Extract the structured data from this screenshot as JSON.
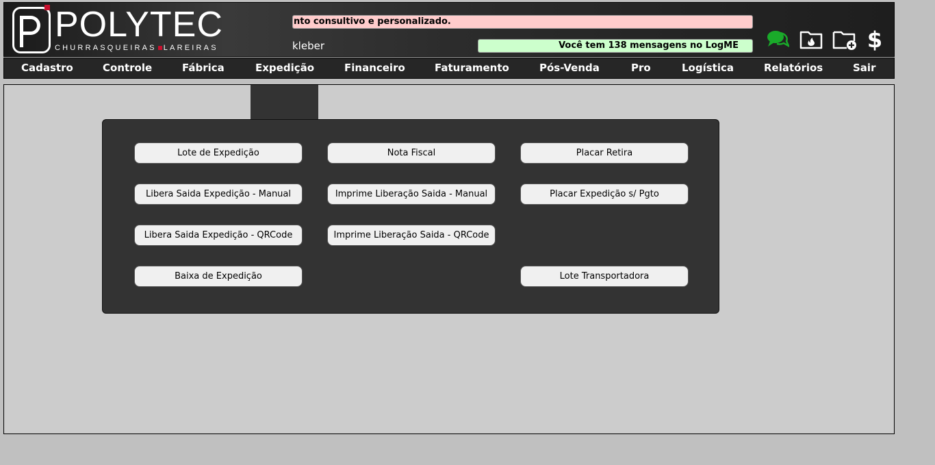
{
  "brand": {
    "name": "POLYTEC",
    "sub_left": "CHURRASQUEIRAS",
    "sub_right": "LAREIRAS",
    "accent": "#c8102e"
  },
  "ticker": {
    "text": "nto consultivo e personalizado.",
    "bg": "#ffcccc"
  },
  "user": {
    "name": "kleber"
  },
  "messages": {
    "text": "Você tem 138 mensagens no LogME",
    "bg": "#ccffcc"
  },
  "header_icons": [
    "chat-bubbles-icon",
    "folder-fire-icon",
    "folder-add-icon",
    "dollar-icon"
  ],
  "menu": [
    {
      "label": "Cadastro"
    },
    {
      "label": "Controle"
    },
    {
      "label": "Fábrica"
    },
    {
      "label": "Expedição"
    },
    {
      "label": "Financeiro"
    },
    {
      "label": "Faturamento"
    },
    {
      "label": "Pós-Venda"
    },
    {
      "label": "Pro"
    },
    {
      "label": "Logística"
    },
    {
      "label": "Relatórios"
    },
    {
      "label": "Sair"
    }
  ],
  "submenu": {
    "col1": [
      "Lote de Expedição",
      "Libera Saida Expedição - Manual",
      "Libera Saida Expedição - QRCode",
      "Baixa de Expedição"
    ],
    "col2": [
      "Nota Fiscal",
      "Imprime Liberação Saida - Manual",
      "Imprime Liberação Saida - QRCode"
    ],
    "col3": [
      "Placar Retira",
      "Placar Expedição s/ Pgto",
      "Lote Transportadora"
    ]
  }
}
